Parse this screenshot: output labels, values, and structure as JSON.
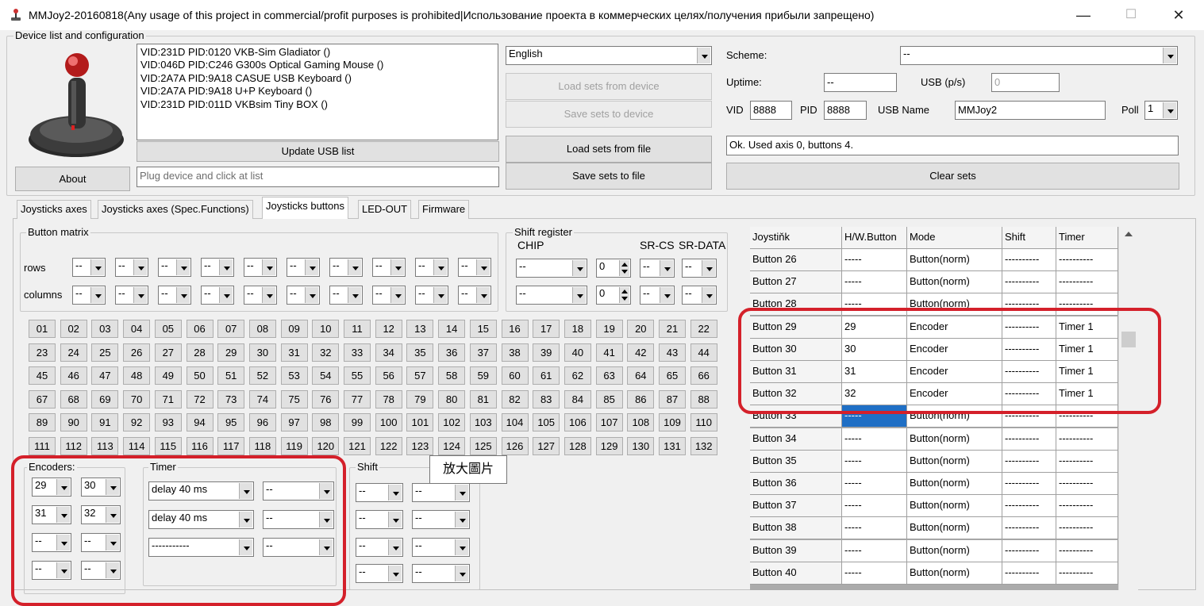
{
  "window": {
    "title": "MMJoy2-20160818(Any usage of this project in commercial/profit purposes is prohibited|Использование проекта в коммерческих целях/получения прибыли запрещено)",
    "minimize": "—",
    "maximize": "☐",
    "close": "✕"
  },
  "device_group": {
    "label": "Device list and configuration",
    "devices": [
      "VID:231D PID:0120  VKB-Sim Gladiator  ()",
      "VID:046D PID:C246 G300s Optical Gaming Mouse ()",
      "VID:2A7A PID:9A18 CASUE USB Keyboard ()",
      "VID:2A7A PID:9A18 U+P Keyboard ()",
      "VID:231D PID:011D VKBsim Tiny BOX  ()"
    ],
    "update_usb": "Update USB list",
    "about": "About",
    "status_placeholder": "Plug device and click at list",
    "language": "English",
    "load_from_device": "Load sets from device",
    "save_to_device": "Save sets to device",
    "load_from_file": "Load sets from file",
    "save_to_file": "Save sets to file",
    "scheme_label": "Scheme:",
    "scheme_value": "--",
    "uptime_label": "Uptime:",
    "uptime_value": "--",
    "usb_ps_label": "USB (p/s)",
    "usb_ps_value": "0",
    "vid_label": "VID",
    "vid_value": "8888",
    "pid_label": "PID",
    "pid_value": "8888",
    "usb_name_label": "USB Name",
    "usb_name_value": "MMJoy2",
    "poll_label": "Poll",
    "poll_value": "1",
    "status_message": "Ok. Used axis  0, buttons 4.",
    "clear_sets": "Clear sets"
  },
  "tabs": [
    {
      "label": "Joysticks axes"
    },
    {
      "label": "Joysticks axes (Spec.Functions)"
    },
    {
      "label": "Joysticks buttons"
    },
    {
      "label": "LED-OUT"
    },
    {
      "label": "Firmware"
    }
  ],
  "button_matrix": {
    "label": "Button matrix",
    "rows_label": "rows",
    "columns_label": "columns",
    "empty": "--"
  },
  "shift_register": {
    "label": "Shift register",
    "chip_label": "CHIP",
    "sr_cs_label": "SR-CS",
    "sr_data_label": "SR-DATA",
    "empty": "--",
    "spin_value": "0"
  },
  "buttons_grid": [
    "01",
    "02",
    "03",
    "04",
    "05",
    "06",
    "07",
    "08",
    "09",
    "10",
    "11",
    "12",
    "13",
    "14",
    "15",
    "16",
    "17",
    "18",
    "19",
    "20",
    "21",
    "22",
    "23",
    "24",
    "25",
    "26",
    "27",
    "28",
    "29",
    "30",
    "31",
    "32",
    "33",
    "34",
    "35",
    "36",
    "37",
    "38",
    "39",
    "40",
    "41",
    "42",
    "43",
    "44",
    "45",
    "46",
    "47",
    "48",
    "49",
    "50",
    "51",
    "52",
    "53",
    "54",
    "55",
    "56",
    "57",
    "58",
    "59",
    "60",
    "61",
    "62",
    "63",
    "64",
    "65",
    "66",
    "67",
    "68",
    "69",
    "70",
    "71",
    "72",
    "73",
    "74",
    "75",
    "76",
    "77",
    "78",
    "79",
    "80",
    "81",
    "82",
    "83",
    "84",
    "85",
    "86",
    "87",
    "88",
    "89",
    "90",
    "91",
    "92",
    "93",
    "94",
    "95",
    "96",
    "97",
    "98",
    "99",
    "100",
    "101",
    "102",
    "103",
    "104",
    "105",
    "106",
    "107",
    "108",
    "109",
    "110",
    "111",
    "112",
    "113",
    "114",
    "115",
    "116",
    "117",
    "118",
    "119",
    "120",
    "121",
    "122",
    "123",
    "124",
    "125",
    "126",
    "127",
    "128",
    "129",
    "130",
    "131",
    "132"
  ],
  "encoders": {
    "label": "Encoders:",
    "values": [
      "29",
      "30",
      "31",
      "32",
      "--",
      "--",
      "--",
      "--"
    ]
  },
  "timer": {
    "label": "Timer",
    "values": [
      "delay 40 ms",
      "--",
      "delay 40 ms",
      "--",
      "-----------",
      "--"
    ]
  },
  "shift": {
    "label": "Shift",
    "empty": "--"
  },
  "tooltip": "放大圖片",
  "table": {
    "headers": [
      "Joystiňk",
      "H/W.Button",
      "Mode",
      "Shift",
      "Timer"
    ],
    "rows": [
      [
        "Button 26",
        "-----",
        "Button(norm)",
        "----------",
        "----------"
      ],
      [
        "Button 27",
        "-----",
        "Button(norm)",
        "----------",
        "----------"
      ],
      [
        "Button 28",
        "-----",
        "Button(norm)",
        "----------",
        "----------"
      ],
      [
        "Button 29",
        "29",
        "Encoder",
        "----------",
        "Timer 1"
      ],
      [
        "Button 30",
        "30",
        "Encoder",
        "----------",
        "Timer 1"
      ],
      [
        "Button 31",
        "31",
        "Encoder",
        "----------",
        "Timer 1"
      ],
      [
        "Button 32",
        "32",
        "Encoder",
        "----------",
        "Timer 1"
      ],
      [
        "Button 33",
        "-----",
        "Button(norm)",
        "----------",
        "----------"
      ],
      [
        "Button 34",
        "-----",
        "Button(norm)",
        "----------",
        "----------"
      ],
      [
        "Button 35",
        "-----",
        "Button(norm)",
        "----------",
        "----------"
      ],
      [
        "Button 36",
        "-----",
        "Button(norm)",
        "----------",
        "----------"
      ],
      [
        "Button 37",
        "-----",
        "Button(norm)",
        "----------",
        "----------"
      ],
      [
        "Button 38",
        "-----",
        "Button(norm)",
        "----------",
        "----------"
      ],
      [
        "Button 39",
        "-----",
        "Button(norm)",
        "----------",
        "----------"
      ],
      [
        "Button 40",
        "-----",
        "Button(norm)",
        "----------",
        "----------"
      ]
    ]
  },
  "colors": {
    "highlight": "#d4202a",
    "selection": "#1f6fc5"
  }
}
